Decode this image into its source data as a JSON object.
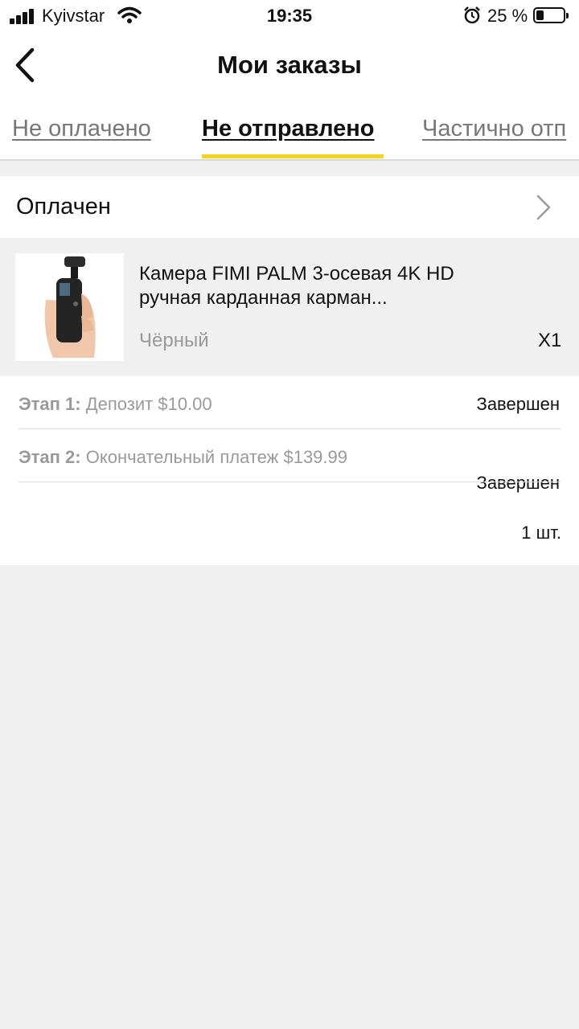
{
  "status_bar": {
    "carrier": "Kyivstar",
    "time": "19:35",
    "battery": "25 %"
  },
  "header": {
    "title": "Мои заказы"
  },
  "tabs": [
    {
      "label": "Не оплачено",
      "active": false
    },
    {
      "label": "Не отправлено",
      "active": true
    },
    {
      "label": "Частично отп",
      "active": false
    }
  ],
  "order": {
    "status": "Оплачен",
    "product": {
      "name": "Камера FIMI PALM 3-осевая 4K HD ручная карданная карман...",
      "variant": "Чёрный",
      "quantity": "X1"
    },
    "stages": [
      {
        "label": "Этап 1:",
        "text": "Депозит $10.00",
        "status": "Завершен"
      },
      {
        "label": "Этап 2:",
        "text": "Окончательный платеж $139.99",
        "status": "Завершен"
      }
    ],
    "count": "1 шт."
  },
  "colors": {
    "accent": "#f7d317",
    "background": "#f0f0f0",
    "muted_text": "#999999"
  },
  "icons": [
    "signal-icon",
    "wifi-icon",
    "alarm-icon",
    "battery-icon",
    "back-icon",
    "chevron-right-icon"
  ]
}
